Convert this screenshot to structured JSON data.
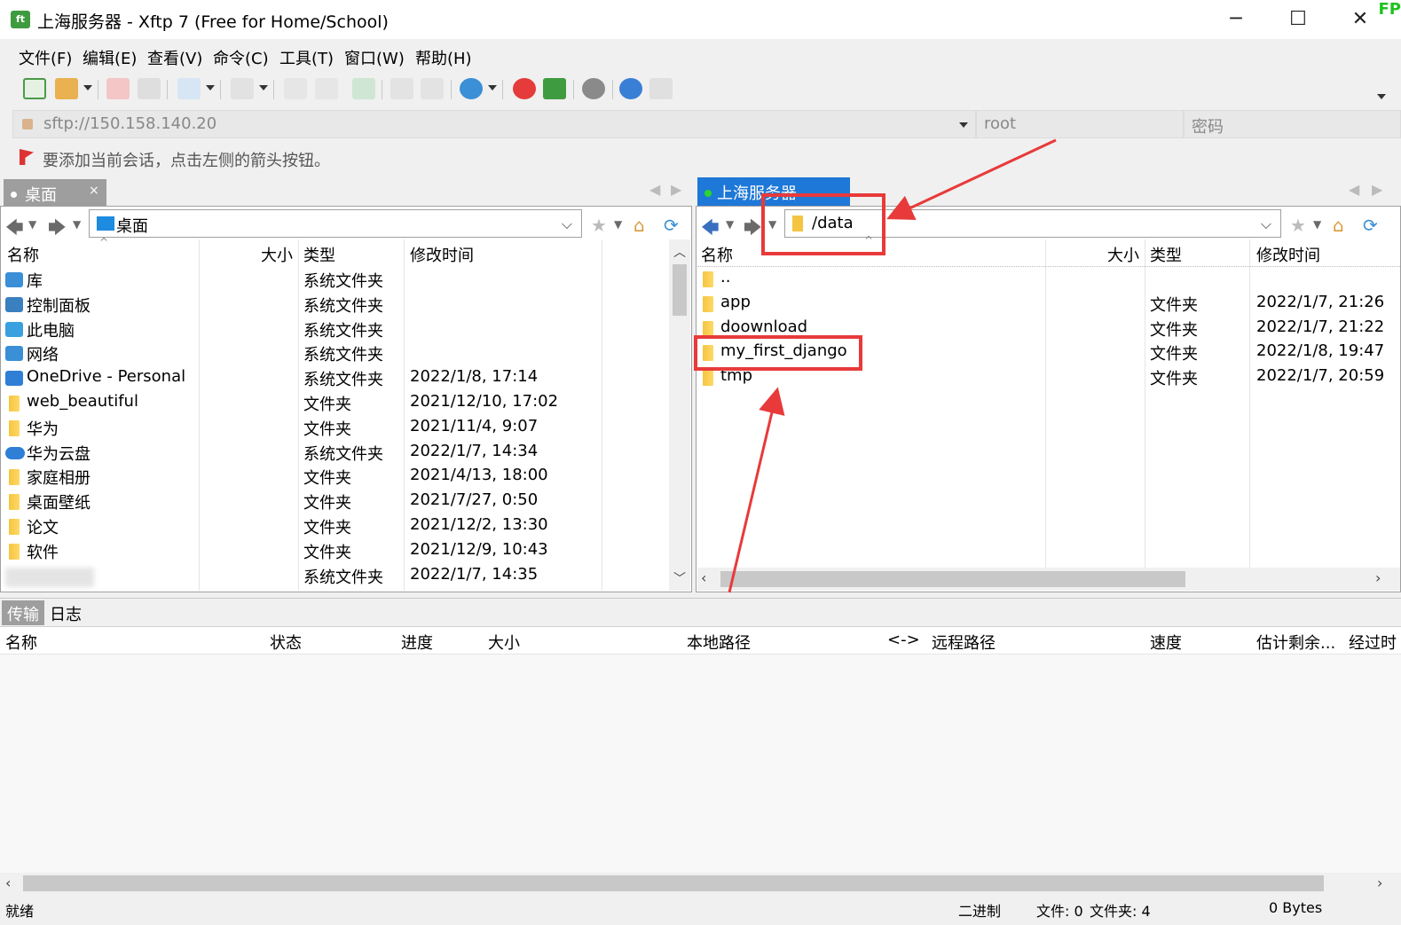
{
  "window": {
    "title": "上海服务器 - Xftp 7 (Free for Home/School)",
    "app_icon_text": "ft",
    "minimize": "─",
    "maximize": "☐",
    "close": "✕",
    "corner_text": "FP"
  },
  "menu": [
    "文件(F)",
    "编辑(E)",
    "查看(V)",
    "命令(C)",
    "工具(T)",
    "窗口(W)",
    "帮助(H)"
  ],
  "address": {
    "url": "sftp://150.158.140.20",
    "user_placeholder": "root",
    "password_placeholder": "密码"
  },
  "hint": "要添加当前会话，点击左侧的箭头按钮。",
  "left_pane": {
    "tab_label": "桌面",
    "tab_close": "×",
    "path": "桌面",
    "columns": [
      "名称",
      "大小",
      "类型",
      "修改时间"
    ],
    "rows": [
      {
        "name": "库",
        "size": "",
        "type": "系统文件夹",
        "modified": ""
      },
      {
        "name": "控制面板",
        "size": "",
        "type": "系统文件夹",
        "modified": ""
      },
      {
        "name": "此电脑",
        "size": "",
        "type": "系统文件夹",
        "modified": ""
      },
      {
        "name": "网络",
        "size": "",
        "type": "系统文件夹",
        "modified": ""
      },
      {
        "name": "OneDrive - Personal",
        "size": "",
        "type": "系统文件夹",
        "modified": "2022/1/8, 17:14"
      },
      {
        "name": "web_beautiful",
        "size": "",
        "type": "文件夹",
        "modified": "2021/12/10, 17:02"
      },
      {
        "name": "华为",
        "size": "",
        "type": "文件夹",
        "modified": "2021/11/4, 9:07"
      },
      {
        "name": "华为云盘",
        "size": "",
        "type": "系统文件夹",
        "modified": "2022/1/7, 14:34"
      },
      {
        "name": "家庭相册",
        "size": "",
        "type": "文件夹",
        "modified": "2021/4/13, 18:00"
      },
      {
        "name": "桌面壁纸",
        "size": "",
        "type": "文件夹",
        "modified": "2021/7/27, 0:50"
      },
      {
        "name": "论文",
        "size": "",
        "type": "文件夹",
        "modified": "2021/12/2, 13:30"
      },
      {
        "name": "软件",
        "size": "",
        "type": "文件夹",
        "modified": "2021/12/9, 10:43"
      },
      {
        "name": "",
        "size": "",
        "type": "系统文件夹",
        "modified": "2022/1/7, 14:35"
      }
    ]
  },
  "right_pane": {
    "tab_label": "上海服务器",
    "path": "/data",
    "columns": [
      "名称",
      "大小",
      "类型",
      "修改时间"
    ],
    "rows": [
      {
        "name": "..",
        "size": "",
        "type": "",
        "modified": ""
      },
      {
        "name": "app",
        "size": "",
        "type": "文件夹",
        "modified": "2022/1/7, 21:26"
      },
      {
        "name": "doownload",
        "size": "",
        "type": "文件夹",
        "modified": "2022/1/7, 21:22"
      },
      {
        "name": "my_first_django",
        "size": "",
        "type": "文件夹",
        "modified": "2022/1/8, 19:47"
      },
      {
        "name": "tmp",
        "size": "",
        "type": "文件夹",
        "modified": "2022/1/7, 20:59"
      }
    ]
  },
  "transfer": {
    "tabs": [
      "传输",
      "日志"
    ],
    "columns": [
      "名称",
      "状态",
      "进度",
      "大小",
      "本地路径",
      "<->",
      "远程路径",
      "速度",
      "估计剩余...",
      "经过时"
    ]
  },
  "status": {
    "ready": "就绪",
    "mode": "二进制",
    "files": "文件: 0",
    "folders": "文件夹: 4",
    "bytes": "0 Bytes"
  },
  "colors": {
    "accent_tab": "#1e78d7",
    "annotation_red": "#e83a3a",
    "folder_yellow": "#f5c542"
  }
}
